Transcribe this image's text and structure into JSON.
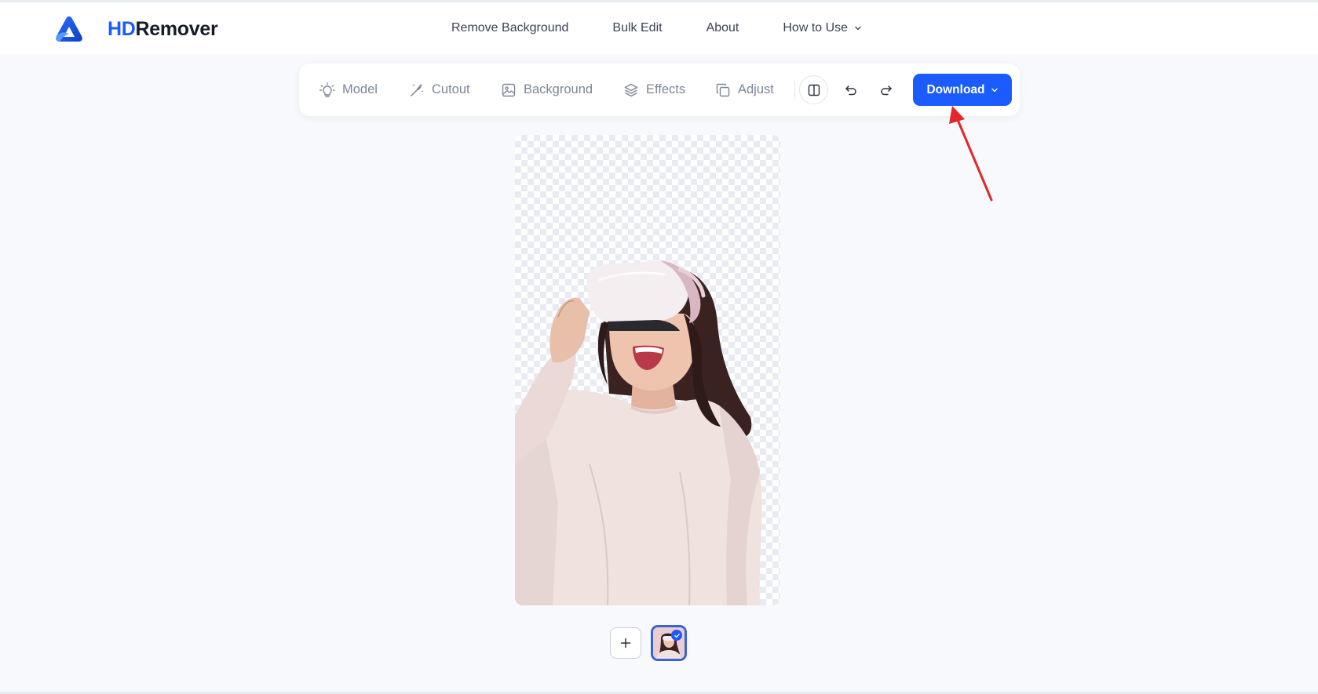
{
  "brand": {
    "name_part1": "HD",
    "name_part2": "Remover"
  },
  "nav": {
    "items": [
      {
        "label": "Remove Background"
      },
      {
        "label": "Bulk Edit"
      },
      {
        "label": "About"
      },
      {
        "label": "How to Use"
      }
    ]
  },
  "toolbar": {
    "tools": [
      {
        "label": "Model",
        "icon": "lightbulb-icon"
      },
      {
        "label": "Cutout",
        "icon": "magic-wand-icon"
      },
      {
        "label": "Background",
        "icon": "image-icon"
      },
      {
        "label": "Effects",
        "icon": "layers-icon"
      },
      {
        "label": "Adjust",
        "icon": "copy-icon"
      }
    ],
    "compare_icon": "split-view-icon",
    "undo_icon": "undo-icon",
    "redo_icon": "redo-icon",
    "download_label": "Download"
  },
  "colors": {
    "accent": "#1a5cff",
    "annotation_arrow": "#e3262c",
    "page_background": "#f7f9fc"
  }
}
